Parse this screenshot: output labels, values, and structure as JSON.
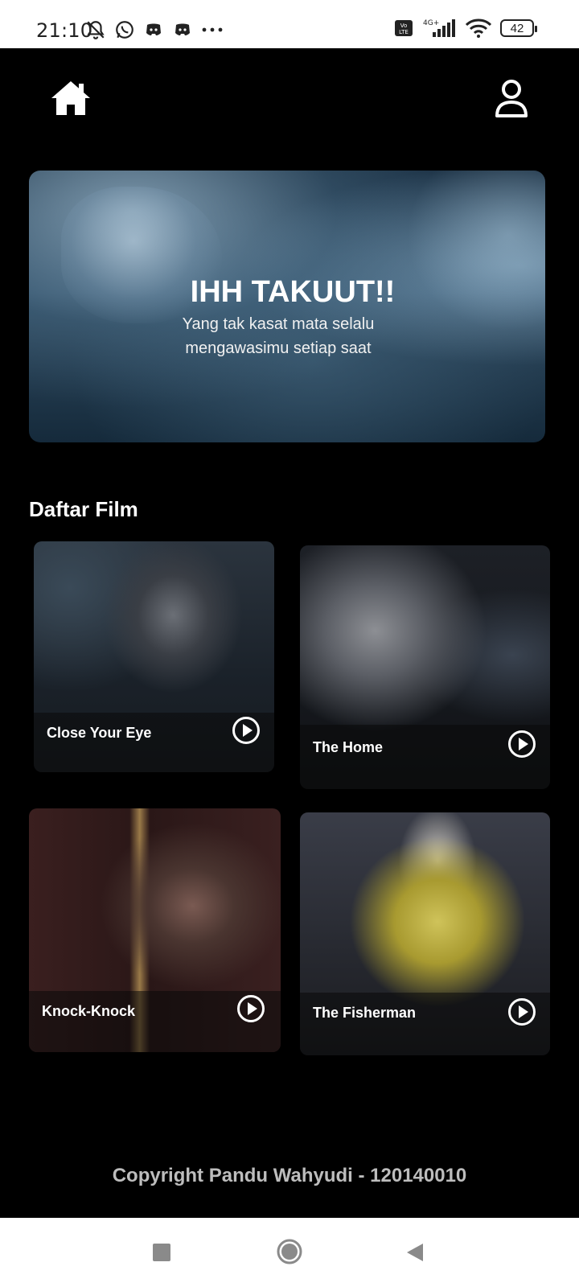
{
  "status_bar": {
    "time": "21:10",
    "left_icons": [
      "bell-off-icon",
      "whatsapp-icon",
      "discord-icon",
      "discord-icon",
      "more-dots-icon"
    ],
    "network_label": "4G+",
    "volte_label": "Vo LTE",
    "battery": "42"
  },
  "header": {
    "home_icon": "home-icon",
    "profile_icon": "user-icon"
  },
  "hero": {
    "title": "IHH TAKUUT!!",
    "subtitle": "Yang tak kasat mata selalu mengawasimu setiap saat"
  },
  "section": {
    "title": "Daftar Film"
  },
  "movies": [
    {
      "title": "Close Your Eye"
    },
    {
      "title": "The Home"
    },
    {
      "title": "Knock-Knock"
    },
    {
      "title": "The Fisherman"
    }
  ],
  "footer": {
    "text": "Copyright Pandu Wahyudi - 120140010"
  },
  "colors": {
    "background": "#000000",
    "text": "#ffffff",
    "footer_text": "#bdbdbd"
  }
}
